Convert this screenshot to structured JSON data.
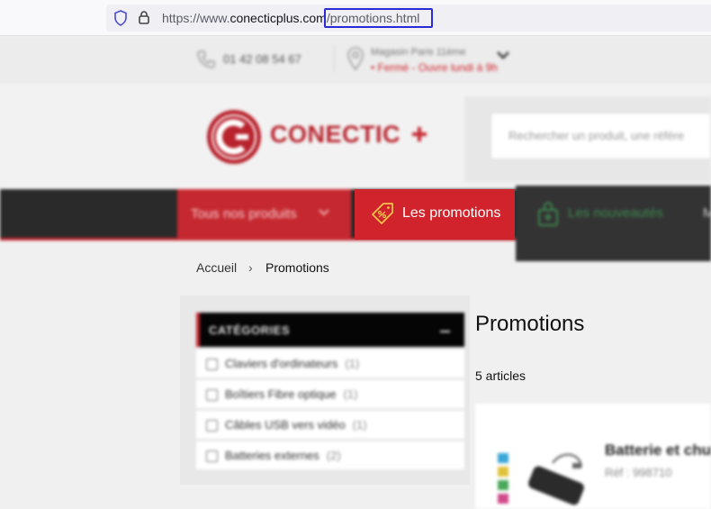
{
  "browser": {
    "url_prefix": "https://www.",
    "url_domain": "conecticplus.com",
    "url_path": "/promotions.html"
  },
  "topbar": {
    "phone": "01 42 08 54 67",
    "store_name": "Magasin Paris 11ème",
    "store_status": "• Fermé - Ouvre lundi à 9h"
  },
  "header": {
    "logo_text": "CONECTIC",
    "search_placeholder": "Rechercher un produit, une référe"
  },
  "nav": {
    "products": "Tous nos produits",
    "promotions": "Les promotions",
    "new": "Les nouveautés",
    "more": "M"
  },
  "breadcrumb": {
    "home": "Accueil",
    "separator": "›",
    "current": "Promotions"
  },
  "sidebar": {
    "title": "CATÉGORIES",
    "items": [
      {
        "label": "Claviers d'ordinateurs",
        "count": "(1)"
      },
      {
        "label": "Boîtiers Fibre optique",
        "count": "(1)"
      },
      {
        "label": "Câbles USB vers vidéo",
        "count": "(1)"
      },
      {
        "label": "Batteries externes",
        "count": "(2)"
      }
    ]
  },
  "main": {
    "title": "Promotions",
    "count": "5 articles",
    "product": {
      "name": "Batterie et chu",
      "ref": "Réf : 998710"
    }
  },
  "colors": {
    "brand_red": "#d0232b",
    "nav_dark": "#2a2a2a",
    "url_highlight": "#2b2bd6"
  }
}
